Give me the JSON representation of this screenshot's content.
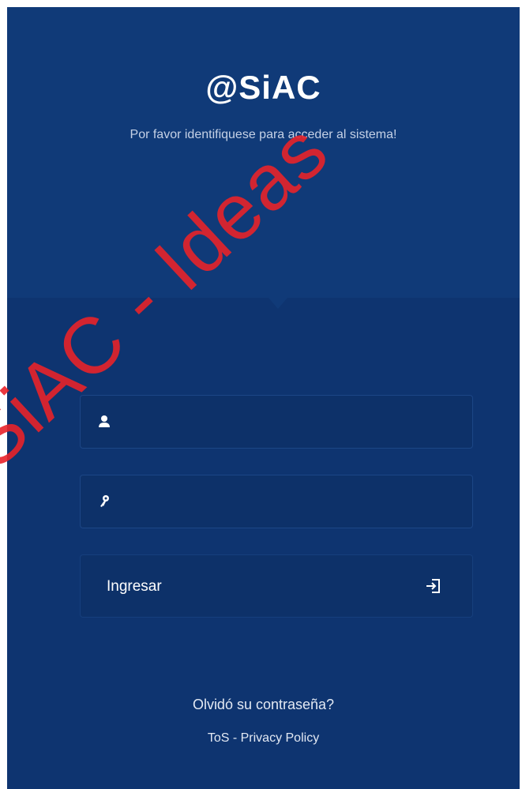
{
  "brand": {
    "logo_text": "@SiAC"
  },
  "login": {
    "subtitle": "Por favor identifiquese para acceder al sistema!",
    "username": {
      "value": "",
      "placeholder": "",
      "icon": "user-icon"
    },
    "password": {
      "value": "",
      "placeholder": "",
      "icon": "key-icon"
    },
    "submit": {
      "label": "Ingresar",
      "icon": "sign-in-icon"
    },
    "forgot_password": "Olvidó su contraseña?"
  },
  "footer": {
    "tos": "ToS",
    "separator": " - ",
    "privacy": "Privacy Policy"
  },
  "watermark": {
    "text": "SiAC - Ideas"
  },
  "colors": {
    "background": "#0e3470",
    "header": "#103a78",
    "watermark": "#e8232a"
  }
}
